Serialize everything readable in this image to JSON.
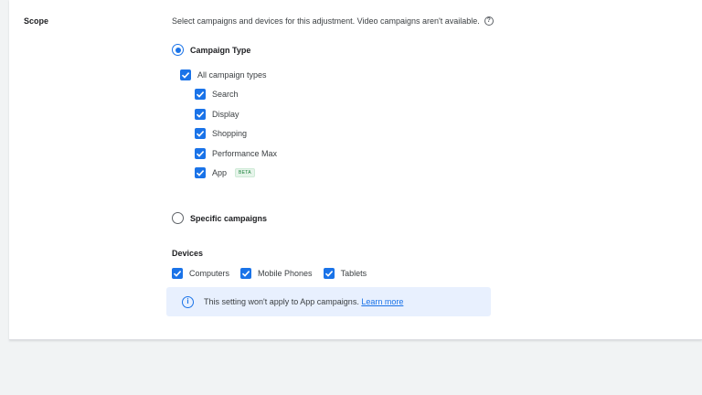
{
  "scope": {
    "label": "Scope",
    "description": "Select campaigns and devices for this adjustment. Video campaigns aren't available.",
    "help_icon": "question-circle-icon"
  },
  "campaign_type": {
    "label": "Campaign Type",
    "selected": true,
    "all_label": "All campaign types",
    "items": [
      {
        "label": "Search",
        "checked": true
      },
      {
        "label": "Display",
        "checked": true
      },
      {
        "label": "Shopping",
        "checked": true
      },
      {
        "label": "Performance Max",
        "checked": true
      },
      {
        "label": "App",
        "checked": true,
        "badge": "BETA"
      }
    ]
  },
  "specific_campaigns": {
    "label": "Specific campaigns",
    "selected": false
  },
  "devices": {
    "title": "Devices",
    "items": [
      {
        "label": "Computers",
        "checked": true
      },
      {
        "label": "Mobile Phones",
        "checked": true
      },
      {
        "label": "Tablets",
        "checked": true
      }
    ]
  },
  "info_banner": {
    "icon": "info-icon",
    "text": "This setting won't apply to App campaigns.",
    "link": "Learn more"
  },
  "colors": {
    "accent": "#1a73e8",
    "background": "#f1f3f4",
    "info_bg": "#e8f0fe"
  }
}
